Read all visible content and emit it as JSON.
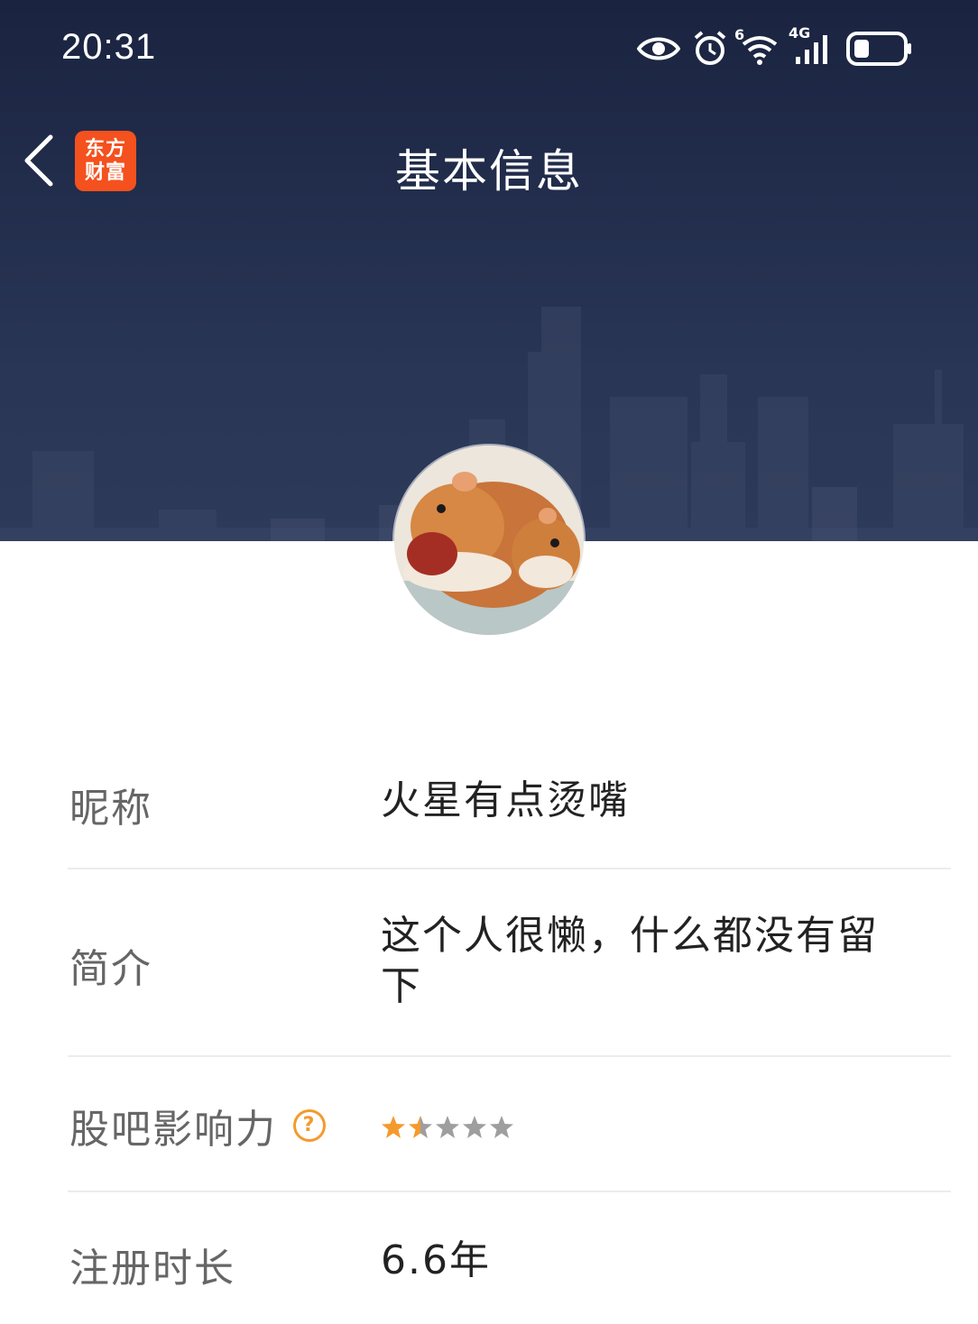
{
  "status_bar": {
    "time": "20:31",
    "icons": [
      "eye-icon",
      "alarm-icon",
      "wifi-icon",
      "signal-4g-icon",
      "battery-icon"
    ],
    "wifi_badge": "6",
    "network_badge": "4G"
  },
  "nav": {
    "title": "基本信息",
    "logo_line1": "东方",
    "logo_line2": "财富",
    "logo_color": "#f4511e"
  },
  "profile": {
    "rows": [
      {
        "label": "昵称",
        "value": "火星有点烫嘴"
      },
      {
        "label": "简介",
        "value": "这个人很懒，什么都没有留下"
      },
      {
        "label": "股吧影响力",
        "value": "",
        "rating": 1.5,
        "rating_max": 5
      },
      {
        "label": "注册时长",
        "value": "6.6年"
      }
    ]
  },
  "colors": {
    "header_bg": "#222d4c",
    "star_active": "#f49a2c",
    "star_inactive": "#9e9e9e",
    "divider": "#ececec"
  }
}
